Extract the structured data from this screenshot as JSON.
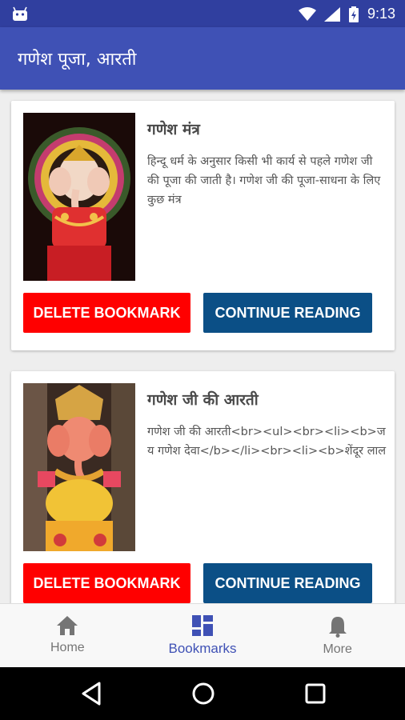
{
  "status_bar": {
    "time": "9:13"
  },
  "app_bar": {
    "title": "गणेश पूजा, आरती"
  },
  "cards": [
    {
      "title": "गणेश मंत्र",
      "description": "हिन्दू धर्म के अनुसार किसी भी कार्य से पहले गणेश जी की पूजा की जाती है। गणेश जी की पूजा-साधना के लिए कुछ मंत्र",
      "delete_label": "DELETE BOOKMARK",
      "continue_label": "CONTINUE READING"
    },
    {
      "title": "गणेश जी की आरती",
      "description": "गणेश जी की आरती<br><ul><br><li><b>जय गणेश देवा</b></li><br><li><b>शेंदूर लाल",
      "delete_label": "DELETE BOOKMARK",
      "continue_label": "CONTINUE READING"
    }
  ],
  "bottom_nav": {
    "items": [
      {
        "label": "Home",
        "icon": "home-icon"
      },
      {
        "label": "Bookmarks",
        "icon": "dashboard-icon",
        "active": true
      },
      {
        "label": "More",
        "icon": "bell-icon"
      }
    ]
  },
  "colors": {
    "status_bar": "#303f9f",
    "app_bar": "#3f51b5",
    "delete_button": "#ff0000",
    "continue_button": "#0b4f86",
    "active_nav": "#3f51b5"
  }
}
